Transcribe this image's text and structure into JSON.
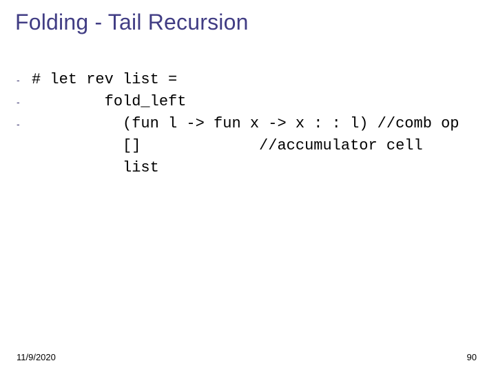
{
  "title": "Folding - Tail Recursion",
  "code": {
    "lines": [
      {
        "bullet": "-",
        "text": "# let rev list ="
      },
      {
        "bullet": "-",
        "text": "        fold_left"
      },
      {
        "bullet": "-",
        "text": "          (fun l -> fun x -> x : : l) //comb op"
      },
      {
        "bullet": "",
        "text": "          []             //accumulator cell"
      },
      {
        "bullet": "",
        "text": "          list"
      }
    ]
  },
  "footer": {
    "date": "11/9/2020",
    "page": "90"
  }
}
